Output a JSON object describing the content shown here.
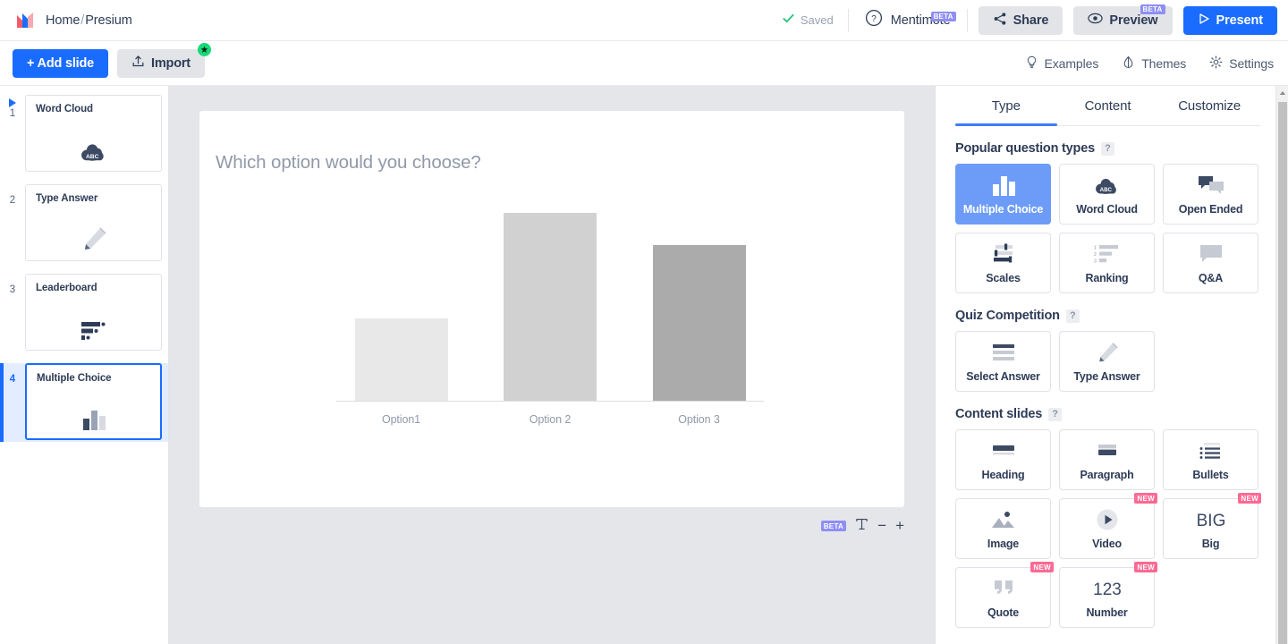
{
  "header": {
    "logo_icon": "mentimeter-logo-icon",
    "breadcrumb_home": "Home",
    "breadcrumb_sep": "/",
    "breadcrumb_current": "Presium",
    "saved_label": "Saved",
    "saved_check_icon": "check-icon",
    "help_icon": "question-circle-icon",
    "mentimote_label": "Mentimote",
    "mentimote_beta": "BETA",
    "share_label": "Share",
    "share_icon": "share-nodes-icon",
    "preview_label": "Preview",
    "preview_icon": "eye-icon",
    "preview_beta": "BETA",
    "present_label": "Present",
    "present_icon": "play-triangle-icon"
  },
  "subbar": {
    "add_slide_label": "+ Add slide",
    "import_label": "Import",
    "import_icon": "upload-icon",
    "import_star_icon": "star-icon",
    "links": [
      {
        "label": "Examples",
        "icon": "lightbulb-icon"
      },
      {
        "label": "Themes",
        "icon": "droplet-icon"
      },
      {
        "label": "Settings",
        "icon": "gear-icon"
      }
    ]
  },
  "slides": [
    {
      "number": "1",
      "title": "Word Cloud",
      "icon": "word-cloud-icon",
      "active": false,
      "playing": true
    },
    {
      "number": "2",
      "title": "Type Answer",
      "icon": "pencil-icon",
      "active": false,
      "playing": false
    },
    {
      "number": "3",
      "title": "Leaderboard",
      "icon": "leaderboard-icon",
      "active": false,
      "playing": false
    },
    {
      "number": "4",
      "title": "Multiple Choice",
      "icon": "bar-chart-icon",
      "active": true,
      "playing": false
    }
  ],
  "canvas": {
    "question": "Which option would you choose?",
    "toolbar": {
      "beta_chip": "BETA",
      "text_icon": "text-format-icon",
      "zoom_out": "−",
      "zoom_in": "+"
    }
  },
  "chart_data": {
    "type": "bar",
    "title": "Which option would you choose?",
    "categories": [
      "Option1",
      "Option 2",
      "Option 3"
    ],
    "values": [
      44,
      100,
      83
    ],
    "colors": [
      "#e8e8e8",
      "#d1d1d1",
      "#ababab"
    ],
    "xlabel": "",
    "ylabel": "",
    "ylim": [
      0,
      100
    ],
    "grid": false,
    "legend": "none"
  },
  "panel": {
    "tabs": [
      {
        "label": "Type",
        "active": true
      },
      {
        "label": "Content",
        "active": false
      },
      {
        "label": "Customize",
        "active": false
      }
    ],
    "sections": [
      {
        "title": "Popular question types",
        "help": "?",
        "cards": [
          {
            "label": "Multiple Choice",
            "icon": "bar-chart-icon",
            "selected": true,
            "badge": ""
          },
          {
            "label": "Word Cloud",
            "icon": "word-cloud-icon",
            "selected": false,
            "badge": ""
          },
          {
            "label": "Open Ended",
            "icon": "speech-bubbles-icon",
            "selected": false,
            "badge": ""
          },
          {
            "label": "Scales",
            "icon": "sliders-icon",
            "selected": false,
            "badge": ""
          },
          {
            "label": "Ranking",
            "icon": "ranking-icon",
            "selected": false,
            "badge": ""
          },
          {
            "label": "Q&A",
            "icon": "qa-bubble-icon",
            "selected": false,
            "badge": ""
          }
        ]
      },
      {
        "title": "Quiz Competition",
        "help": "?",
        "cards": [
          {
            "label": "Select Answer",
            "icon": "select-answer-icon",
            "selected": false,
            "badge": ""
          },
          {
            "label": "Type Answer",
            "icon": "pencil-icon",
            "selected": false,
            "badge": ""
          }
        ]
      },
      {
        "title": "Content slides",
        "help": "?",
        "cards": [
          {
            "label": "Heading",
            "icon": "heading-icon",
            "selected": false,
            "badge": ""
          },
          {
            "label": "Paragraph",
            "icon": "paragraph-icon",
            "selected": false,
            "badge": ""
          },
          {
            "label": "Bullets",
            "icon": "bullets-icon",
            "selected": false,
            "badge": ""
          },
          {
            "label": "Image",
            "icon": "image-icon",
            "selected": false,
            "badge": ""
          },
          {
            "label": "Video",
            "icon": "video-play-icon",
            "selected": false,
            "badge": "NEW"
          },
          {
            "label": "Big",
            "icon": "big-text-icon",
            "selected": false,
            "badge": "NEW"
          },
          {
            "label": "Quote",
            "icon": "quote-icon",
            "selected": false,
            "badge": "NEW"
          },
          {
            "label": "Number",
            "icon": "number-123-icon",
            "selected": false,
            "badge": "NEW"
          }
        ]
      }
    ]
  },
  "theme": {
    "accent_blue": "#196cff",
    "selected_blue": "#6c9cf8",
    "badge_pink": "#fd6a93",
    "beta_purple": "#8e8ef5",
    "canvas_grey": "#e4e6ea",
    "text_navy": "#2e3c57"
  }
}
